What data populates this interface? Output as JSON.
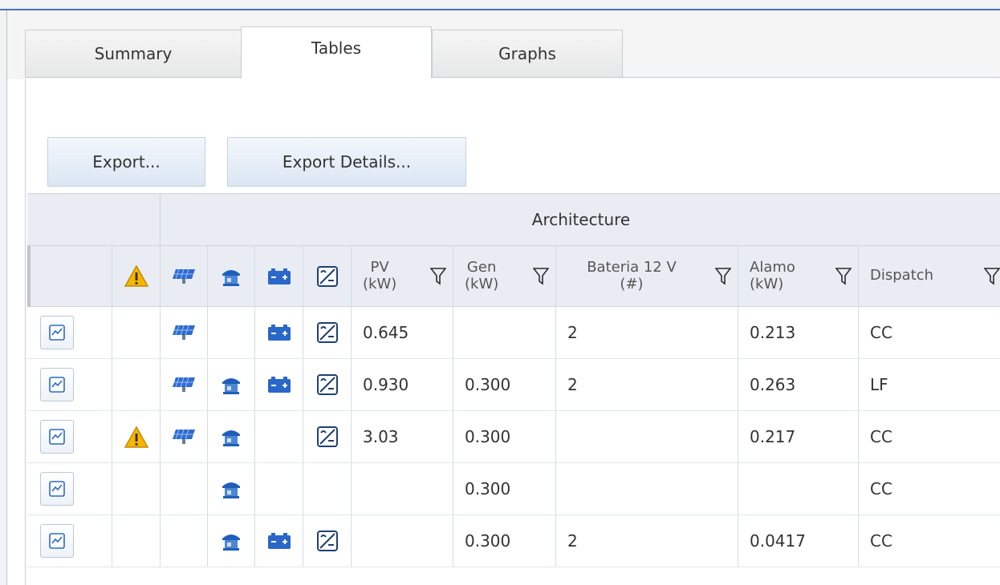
{
  "tabs": [
    {
      "label": "Summary",
      "active": false
    },
    {
      "label": "Tables",
      "active": true
    },
    {
      "label": "Graphs",
      "active": false
    }
  ],
  "toolbar": {
    "export_label": "Export...",
    "export_details_label": "Export Details..."
  },
  "table": {
    "group_header": "Architecture",
    "columns": {
      "pv": {
        "line1": "PV",
        "line2": "(kW)"
      },
      "gen": {
        "line1": "Gen",
        "line2": "(kW)"
      },
      "bateria": {
        "line1": "Bateria 12 V",
        "line2": "(#)"
      },
      "alamo": {
        "line1": "Alamo",
        "line2": "(kW)"
      },
      "dispatch": {
        "line1": "Dispatch"
      }
    },
    "icons": {
      "warning": "warning-icon",
      "pv": "solar-panel-icon",
      "gen": "generator-icon",
      "battery": "battery-icon",
      "converter": "converter-icon",
      "filter": "filter-icon",
      "plot": "chart-icon"
    },
    "rows": [
      {
        "warning": false,
        "pv": true,
        "gen": false,
        "battery": true,
        "converter": true,
        "pv_kw": "0.645",
        "gen_kw": "",
        "bateria": "2",
        "alamo": "0.213",
        "dispatch": "CC"
      },
      {
        "warning": false,
        "pv": true,
        "gen": true,
        "battery": true,
        "converter": true,
        "pv_kw": "0.930",
        "gen_kw": "0.300",
        "bateria": "2",
        "alamo": "0.263",
        "dispatch": "LF"
      },
      {
        "warning": true,
        "pv": true,
        "gen": true,
        "battery": false,
        "converter": true,
        "pv_kw": "3.03",
        "gen_kw": "0.300",
        "bateria": "",
        "alamo": "0.217",
        "dispatch": "CC"
      },
      {
        "warning": false,
        "pv": false,
        "gen": true,
        "battery": false,
        "converter": false,
        "pv_kw": "",
        "gen_kw": "0.300",
        "bateria": "",
        "alamo": "",
        "dispatch": "CC"
      },
      {
        "warning": false,
        "pv": false,
        "gen": true,
        "battery": true,
        "converter": true,
        "pv_kw": "",
        "gen_kw": "0.300",
        "bateria": "2",
        "alamo": "0.0417",
        "dispatch": "CC"
      }
    ]
  },
  "colors": {
    "accent": "#4a73b5",
    "warning": "#f5b800",
    "solar": "#2f6bd0",
    "battery": "#2a67c9",
    "generator": "#1f5fb8"
  }
}
